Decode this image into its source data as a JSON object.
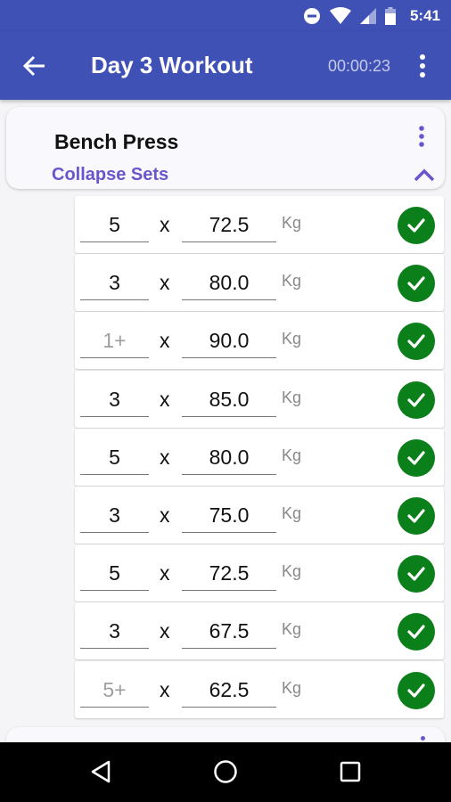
{
  "status_bar": {
    "time": "5:41",
    "icons": [
      "do-not-disturb-icon",
      "wifi-icon",
      "cell-signal-icon",
      "battery-icon"
    ]
  },
  "app_bar": {
    "back_icon": "arrow-left-icon",
    "title": "Day 3 Workout",
    "timer": "00:00:23",
    "menu_icon": "more-vert-icon"
  },
  "exercise": {
    "name": "Bench Press",
    "toggle_label": "Collapse Sets",
    "menu_icon": "more-vert-icon",
    "chevron_icon": "chevron-up-icon",
    "accent_color": "#6a56cc"
  },
  "sets": [
    {
      "reps": "5",
      "amrap": false,
      "times": "x",
      "weight": "72.5",
      "unit": "Kg",
      "completed": true
    },
    {
      "reps": "3",
      "amrap": false,
      "times": "x",
      "weight": "80.0",
      "unit": "Kg",
      "completed": true
    },
    {
      "reps": "1+",
      "amrap": true,
      "times": "x",
      "weight": "90.0",
      "unit": "Kg",
      "completed": true
    },
    {
      "reps": "3",
      "amrap": false,
      "times": "x",
      "weight": "85.0",
      "unit": "Kg",
      "completed": true
    },
    {
      "reps": "5",
      "amrap": false,
      "times": "x",
      "weight": "80.0",
      "unit": "Kg",
      "completed": true
    },
    {
      "reps": "3",
      "amrap": false,
      "times": "x",
      "weight": "75.0",
      "unit": "Kg",
      "completed": true
    },
    {
      "reps": "5",
      "amrap": false,
      "times": "x",
      "weight": "72.5",
      "unit": "Kg",
      "completed": true
    },
    {
      "reps": "3",
      "amrap": false,
      "times": "x",
      "weight": "67.5",
      "unit": "Kg",
      "completed": true
    },
    {
      "reps": "5+",
      "amrap": true,
      "times": "x",
      "weight": "62.5",
      "unit": "Kg",
      "completed": true
    }
  ],
  "colors": {
    "primary": "#3f51b5",
    "check_green": "#0b7f1a"
  },
  "nav_bar": {
    "icons": [
      "back-triangle-icon",
      "home-circle-icon",
      "recents-square-icon"
    ]
  }
}
